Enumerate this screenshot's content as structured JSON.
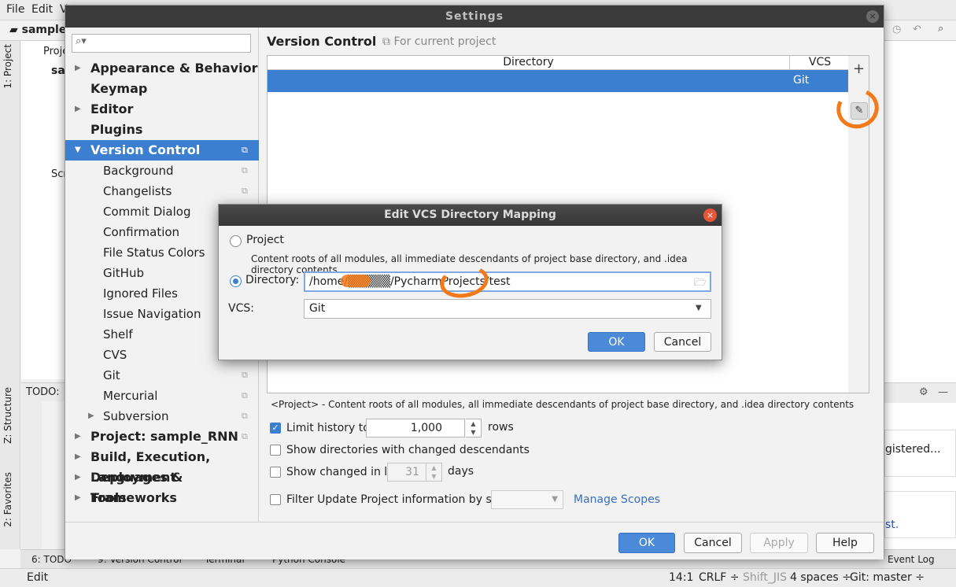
{
  "ide": {
    "menu": [
      "File",
      "Edit",
      "V"
    ],
    "project_crumb": "sample_",
    "project_panel": {
      "header": "Proje",
      "root": "sa",
      "scratch": "Scr"
    },
    "left_tabs": {
      "project": "1: Project",
      "structure": "Z: Structure",
      "favorites": "2: Favorites"
    },
    "todo_label": "TODO:",
    "bottom_tabs": [
      "6: TODO",
      "9: Version Control",
      "Terminal",
      "Python Console"
    ],
    "event_log": "Event Log",
    "right_notif_1": "gistered...",
    "right_notif_2": "st.",
    "status": {
      "left": "Edit",
      "position": "14:1",
      "line_sep": "CRLF ÷",
      "encoding": "Shift_JIS",
      "indent": "4 spaces ÷",
      "branch": "Git: master ÷"
    }
  },
  "settings": {
    "title": "Settings",
    "close_glyph": "×",
    "search_placeholder": "",
    "nav": [
      {
        "label": "Appearance & Behavior",
        "arrow": "▶",
        "level": 0
      },
      {
        "label": "Keymap",
        "arrow": "",
        "level": 0
      },
      {
        "label": "Editor",
        "arrow": "▶",
        "level": 0
      },
      {
        "label": "Plugins",
        "arrow": "",
        "level": 0
      },
      {
        "label": "Version Control",
        "arrow": "▼",
        "level": 0,
        "selected": true,
        "copy": true
      },
      {
        "label": "Background",
        "level": 1,
        "copy": true
      },
      {
        "label": "Changelists",
        "level": 1,
        "copy": true
      },
      {
        "label": "Commit Dialog",
        "level": 1,
        "copy": true
      },
      {
        "label": "Confirmation",
        "level": 1,
        "copy": true
      },
      {
        "label": "File Status Colors",
        "level": 1,
        "copy": false
      },
      {
        "label": "GitHub",
        "level": 1,
        "copy": false
      },
      {
        "label": "Ignored Files",
        "level": 1,
        "copy": true
      },
      {
        "label": "Issue Navigation",
        "level": 1,
        "copy": true
      },
      {
        "label": "Shelf",
        "level": 1,
        "copy": true
      },
      {
        "label": "CVS",
        "level": 1,
        "copy": false
      },
      {
        "label": "Git",
        "level": 1,
        "copy": true
      },
      {
        "label": "Mercurial",
        "level": 1,
        "copy": true
      },
      {
        "label": "Subversion",
        "arrow": "▶",
        "level": 1,
        "copy": true
      },
      {
        "label": "Project: sample_RNN",
        "arrow": "▶",
        "level": 0,
        "copy": true
      },
      {
        "label": "Build, Execution, Deployment",
        "arrow": "▶",
        "level": 0
      },
      {
        "label": "Languages & Frameworks",
        "arrow": "▶",
        "level": 0
      },
      {
        "label": "Tools",
        "arrow": "▶",
        "level": 0
      }
    ],
    "content": {
      "heading": "Version Control",
      "scope_text": "For current project",
      "table": {
        "columns": [
          "Directory",
          "VCS"
        ],
        "rows": [
          {
            "directory": "",
            "vcs": "Git"
          }
        ]
      },
      "add_glyph": "+",
      "edit_glyph": "✎",
      "note": "<Project> - Content roots of all modules, all immediate descendants of project base directory, and .idea directory contents",
      "limit_history": {
        "label": "Limit history to:",
        "checked": true,
        "value": "1,000",
        "unit": "rows"
      },
      "show_dirs_changed": {
        "label": "Show directories with changed descendants",
        "checked": false
      },
      "show_changed_last": {
        "label": "Show changed in last",
        "checked": false,
        "value": "31",
        "unit": "days"
      },
      "filter_update": {
        "label": "Filter Update Project information by scope",
        "checked": false
      },
      "manage_scopes": "Manage Scopes"
    },
    "footer": {
      "ok": "OK",
      "cancel": "Cancel",
      "apply": "Apply",
      "help": "Help"
    }
  },
  "modal": {
    "title": "Edit VCS Directory Mapping",
    "close_glyph": "×",
    "project_option": "Project",
    "project_desc": "Content roots of all modules, all immediate descendants of project base directory, and .idea directory contents",
    "directory_label": "Directory:",
    "directory_value": "/home/▒▒▒▒▒/PycharmProjects/test",
    "vcs_label": "VCS:",
    "vcs_value": "Git",
    "ok": "OK",
    "cancel": "Cancel"
  },
  "colors": {
    "selection": "#3c7fd1",
    "annotation": "#f27a1a",
    "title_bar": "#3b3b3b",
    "modal_close": "#e8563a"
  }
}
